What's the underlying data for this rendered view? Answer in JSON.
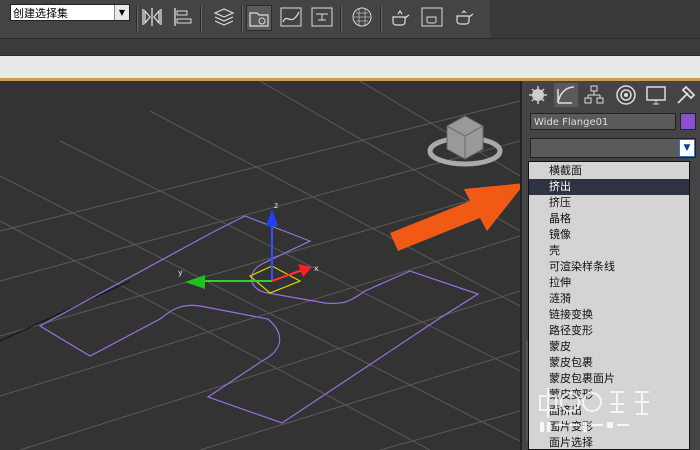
{
  "toolbar": {
    "selection_set": "创建选择集",
    "icons": [
      "mirror-icon",
      "align-icon",
      "layer-manager-icon",
      "scene-explorer-icon",
      "curve-editor-icon",
      "schematic-view-icon",
      "material-editor-icon",
      "render-setup-icon",
      "rendered-frame-icon",
      "render-icon"
    ]
  },
  "panel": {
    "tabs": [
      "create-icon",
      "modify-icon",
      "hierarchy-icon",
      "motion-icon",
      "display-icon",
      "utilities-icon"
    ],
    "object_name": "Wide Flange01",
    "object_color": "#8b4fd0"
  },
  "dropdown": {
    "items": [
      "横截面",
      "挤出",
      "挤压",
      "晶格",
      "镜像",
      "壳",
      "可渲染样条线",
      "拉伸",
      "涟漪",
      "链接变换",
      "路径变形",
      "蒙皮",
      "蒙皮包裹",
      "蒙皮包裹面片",
      "蒙皮变形",
      "面挤出",
      "面片变形",
      "面片选择"
    ],
    "selected_index": 1
  },
  "viewport": {
    "gizmo_axes": [
      "x",
      "y",
      "z"
    ]
  },
  "colors": {
    "arrow": "#f05a14",
    "shape": "#9a6fe0",
    "selected": "#2f3240"
  }
}
